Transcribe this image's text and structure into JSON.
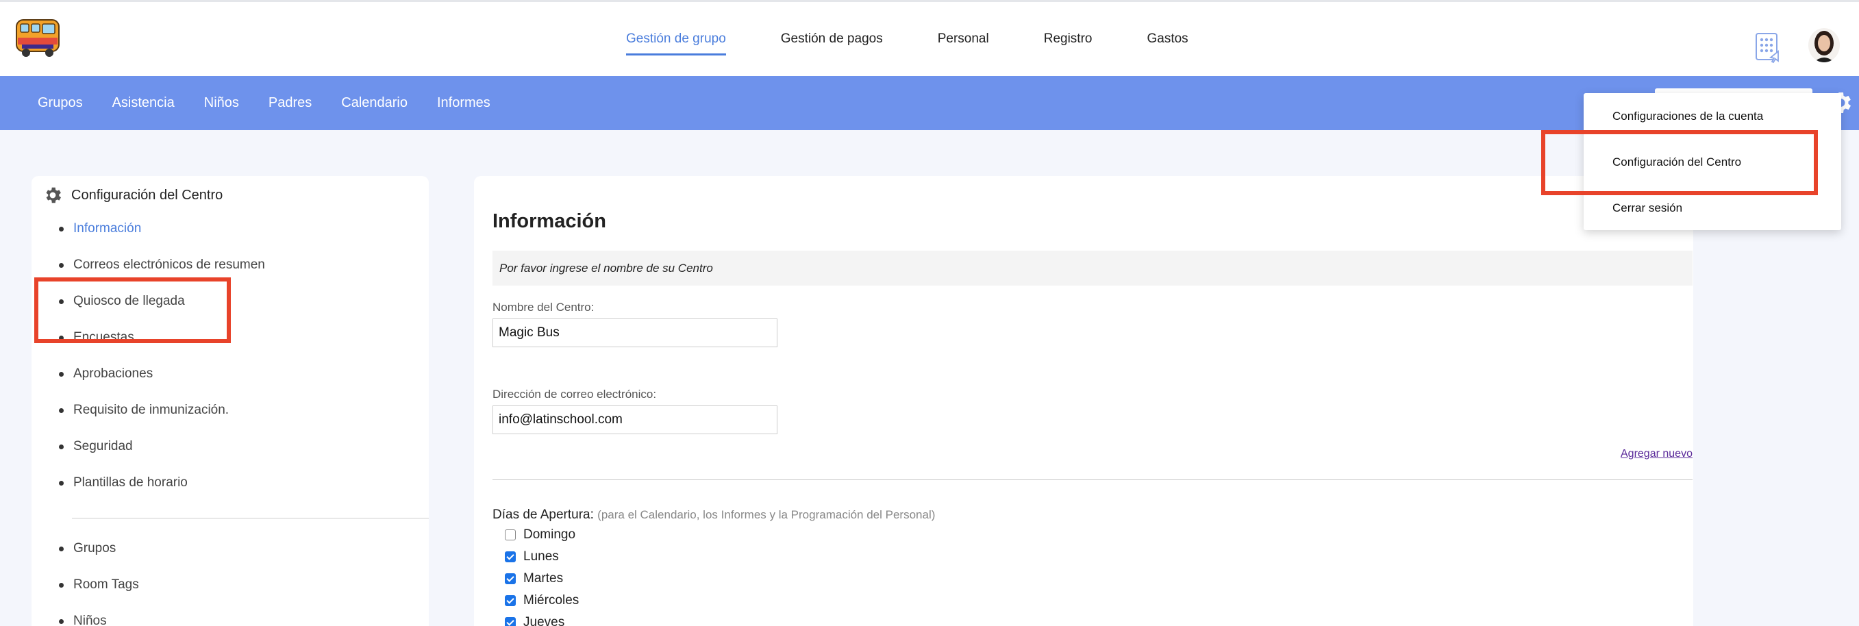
{
  "colors": {
    "accent": "#4a7ddc",
    "subnav_bg": "#6e92ec",
    "highlight": "#e8432a"
  },
  "topnav": {
    "items": [
      {
        "label": "Gestión de grupo",
        "active": true
      },
      {
        "label": "Gestión de pagos",
        "active": false
      },
      {
        "label": "Personal",
        "active": false
      },
      {
        "label": "Registro",
        "active": false
      },
      {
        "label": "Gastos",
        "active": false
      }
    ]
  },
  "subnav": {
    "items": [
      {
        "label": "Grupos"
      },
      {
        "label": "Asistencia"
      },
      {
        "label": "Niños"
      },
      {
        "label": "Padres"
      },
      {
        "label": "Calendario"
      },
      {
        "label": "Informes"
      }
    ]
  },
  "dropdown": {
    "items": [
      {
        "label": "Configuraciones de la cuenta"
      },
      {
        "label": "Configuración del Centro"
      },
      {
        "label": "Cerrar sesión"
      }
    ]
  },
  "sidebar": {
    "title": "Configuración del Centro",
    "items": [
      {
        "label": "Información",
        "active": true
      },
      {
        "label": "Correos electrónicos de resumen"
      },
      {
        "label": "Quiosco de llegada"
      },
      {
        "label": "Encuestas"
      },
      {
        "label": "Aprobaciones"
      },
      {
        "label": "Requisito de inmunización."
      },
      {
        "label": "Seguridad"
      },
      {
        "label": "Plantillas de horario"
      }
    ],
    "items2": [
      {
        "label": "Grupos"
      },
      {
        "label": "Room Tags"
      },
      {
        "label": "Niños"
      }
    ]
  },
  "main": {
    "title": "Información",
    "notice": "Por favor ingrese el nombre de su Centro",
    "center_name_label": "Nombre del Centro:",
    "center_name_value": "Magic Bus",
    "email_label": "Dirección de correo electrónico:",
    "email_value": "info@latinschool.com",
    "add_new": "Agregar nuevo",
    "days_label": "Días de Apertura:",
    "days_hint": "(para el Calendario, los Informes y la Programación del Personal)",
    "days": [
      {
        "label": "Domingo",
        "checked": false
      },
      {
        "label": "Lunes",
        "checked": true
      },
      {
        "label": "Martes",
        "checked": true
      },
      {
        "label": "Miércoles",
        "checked": true
      },
      {
        "label": "Jueves",
        "checked": true
      }
    ]
  }
}
